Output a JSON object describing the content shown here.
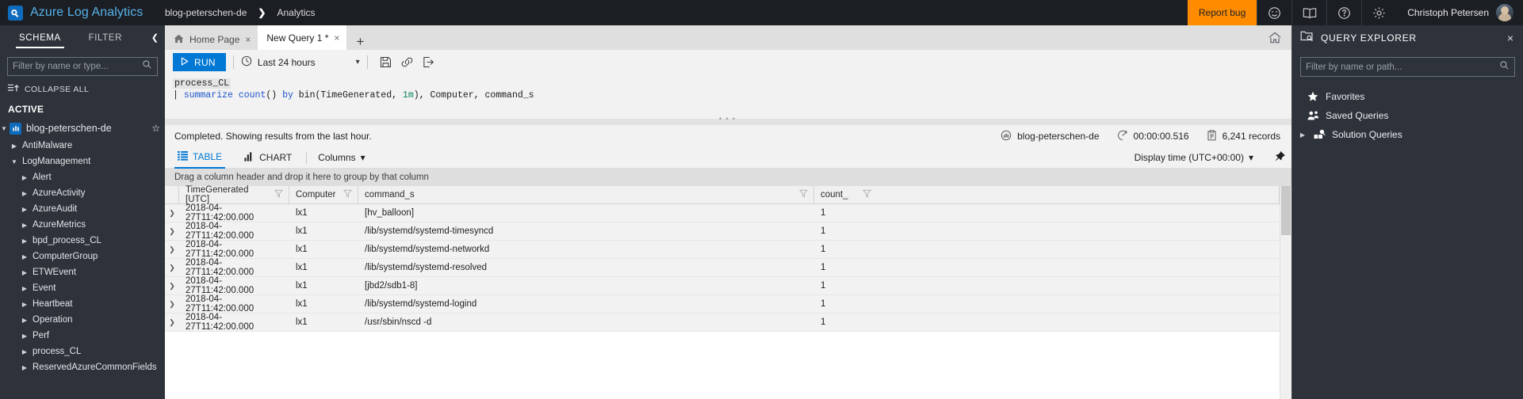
{
  "topbar": {
    "brand": "Azure Log Analytics",
    "brand_logo_icon": "azure-log-analytics-logo",
    "breadcrumb": [
      "blog-peterschen-de",
      "Analytics"
    ],
    "breadcrumb_separator": "❯",
    "report_bug": "Report bug",
    "icons": [
      "smiley-icon",
      "book-icon",
      "help-icon",
      "gear-icon"
    ],
    "user_name": "Christoph Petersen",
    "avatar_icon": "user-avatar"
  },
  "schema": {
    "tab_schema": "SCHEMA",
    "tab_filter": "FILTER",
    "collapse_panel_icon": "chevron-left-icon",
    "filter_placeholder": "Filter by name or type...",
    "search_icon": "search-icon",
    "collapse_all": "COLLAPSE ALL",
    "collapse_all_icon": "collapse-all-icon",
    "active_label": "ACTIVE",
    "workspace": "blog-peterschen-de",
    "workspace_icon": "workspace-icon",
    "favorite_icon": "star-icon",
    "nodes": [
      {
        "label": "AntiMalware",
        "level": 1,
        "expanded": false
      },
      {
        "label": "LogManagement",
        "level": 1,
        "expanded": true
      },
      {
        "label": "Alert",
        "level": 2,
        "expanded": false
      },
      {
        "label": "AzureActivity",
        "level": 2,
        "expanded": false
      },
      {
        "label": "AzureAudit",
        "level": 2,
        "expanded": false
      },
      {
        "label": "AzureMetrics",
        "level": 2,
        "expanded": false
      },
      {
        "label": "bpd_process_CL",
        "level": 2,
        "expanded": false
      },
      {
        "label": "ComputerGroup",
        "level": 2,
        "expanded": false
      },
      {
        "label": "ETWEvent",
        "level": 2,
        "expanded": false
      },
      {
        "label": "Event",
        "level": 2,
        "expanded": false
      },
      {
        "label": "Heartbeat",
        "level": 2,
        "expanded": false
      },
      {
        "label": "Operation",
        "level": 2,
        "expanded": false
      },
      {
        "label": "Perf",
        "level": 2,
        "expanded": false
      },
      {
        "label": "process_CL",
        "level": 2,
        "expanded": false
      },
      {
        "label": "ReservedAzureCommonFields",
        "level": 2,
        "expanded": false
      }
    ]
  },
  "tabs": {
    "home_page": "Home Page",
    "home_icon": "home-icon",
    "new_query": "New Query 1 *",
    "close_icon": "×",
    "add_tab_icon": "plus-icon",
    "home_button_icon": "home-icon"
  },
  "toolbar": {
    "run_label": "RUN",
    "run_icon": "play-icon",
    "time_range": "Last 24 hours",
    "clock_icon": "clock-icon",
    "chevron_icon": "chevron-down-icon",
    "save_icon": "save-icon",
    "link_icon": "link-icon",
    "export_icon": "export-icon"
  },
  "editor": {
    "line1": "process_CL",
    "line2_pipe": "|",
    "line2_kw": "summarize",
    "line2_fn": "count",
    "line2_parens": "()",
    "line2_by": "by",
    "line2_bin": " bin(TimeGenerated, ",
    "line2_num": "1m",
    "line2_rest": "), Computer, command_s",
    "grip_icon": "drag-grip"
  },
  "status": {
    "message": "Completed. Showing results from the last hour.",
    "workspace": "blog-peterschen-de",
    "workspace_icon": "workspace-icon",
    "duration": "00:00:00.516",
    "duration_icon": "timer-icon",
    "records": "6,241 records",
    "records_icon": "records-icon"
  },
  "result_tabs": {
    "table": "TABLE",
    "table_icon": "table-icon",
    "chart": "CHART",
    "chart_icon": "bar-chart-icon",
    "columns": "Columns",
    "columns_chevron": "chevron-down-icon",
    "display_time": "Display time (UTC+00:00)",
    "display_time_chevron": "chevron-down-icon",
    "pin_icon": "pin-icon"
  },
  "grid": {
    "group_hint": "Drag a column header and drop it here to group by that column",
    "filter_icon": "funnel-icon",
    "expand_icon": "chevron-right-icon",
    "columns": [
      "TimeGenerated [UTC]",
      "Computer",
      "command_s",
      "count_"
    ],
    "rows": [
      {
        "time": "2018-04-27T11:42:00.000",
        "computer": "lx1",
        "command": "[hv_balloon]",
        "count": "1"
      },
      {
        "time": "2018-04-27T11:42:00.000",
        "computer": "lx1",
        "command": "/lib/systemd/systemd-timesyncd",
        "count": "1"
      },
      {
        "time": "2018-04-27T11:42:00.000",
        "computer": "lx1",
        "command": "/lib/systemd/systemd-networkd",
        "count": "1"
      },
      {
        "time": "2018-04-27T11:42:00.000",
        "computer": "lx1",
        "command": "/lib/systemd/systemd-resolved",
        "count": "1"
      },
      {
        "time": "2018-04-27T11:42:00.000",
        "computer": "lx1",
        "command": "[jbd2/sdb1-8]",
        "count": "1"
      },
      {
        "time": "2018-04-27T11:42:00.000",
        "computer": "lx1",
        "command": "/lib/systemd/systemd-logind",
        "count": "1"
      },
      {
        "time": "2018-04-27T11:42:00.000",
        "computer": "lx1",
        "command": "/usr/sbin/nscd -d",
        "count": "1"
      }
    ]
  },
  "query_explorer": {
    "title": "QUERY EXPLORER",
    "title_icon": "query-explorer-icon",
    "close_icon": "×",
    "filter_placeholder": "Filter by name or path...",
    "search_icon": "search-icon",
    "items": [
      {
        "label": "Favorites",
        "icon": "star-icon",
        "expandable": false
      },
      {
        "label": "Saved Queries",
        "icon": "saved-queries-icon",
        "expandable": false
      },
      {
        "label": "Solution Queries",
        "icon": "solution-queries-icon",
        "expandable": true
      }
    ]
  },
  "colors": {
    "accent_blue": "#0078d4",
    "brand_text": "#57b0e8",
    "orange": "#ff8c00",
    "dark_panel": "#2e333b",
    "topbar": "#1b1f24"
  }
}
